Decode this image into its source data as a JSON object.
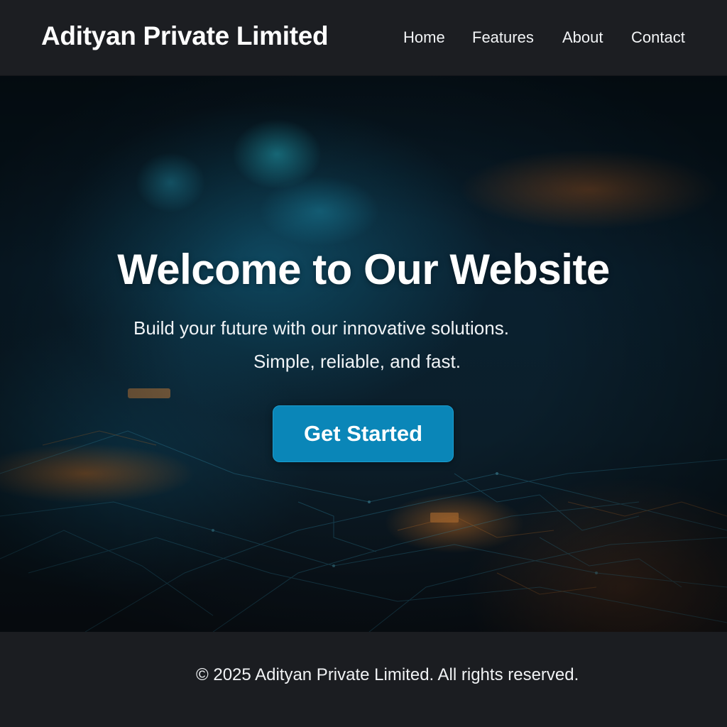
{
  "header": {
    "brand": "Adityan Private Limited",
    "nav": [
      {
        "label": "Home"
      },
      {
        "label": "Features"
      },
      {
        "label": "About"
      },
      {
        "label": "Contact"
      }
    ]
  },
  "hero": {
    "title": "Welcome to Our Website",
    "subtitle_line1": "Build your future with our innovative solutions.",
    "subtitle_line2": "Simple, reliable, and fast.",
    "cta_label": "Get Started"
  },
  "footer": {
    "copyright": "© 2025 Adityan Private Limited. All rights reserved."
  },
  "colors": {
    "header_bg": "#1c1e22",
    "footer_bg": "#1b1d21",
    "accent": "#0a86b8",
    "text": "#ffffff"
  }
}
